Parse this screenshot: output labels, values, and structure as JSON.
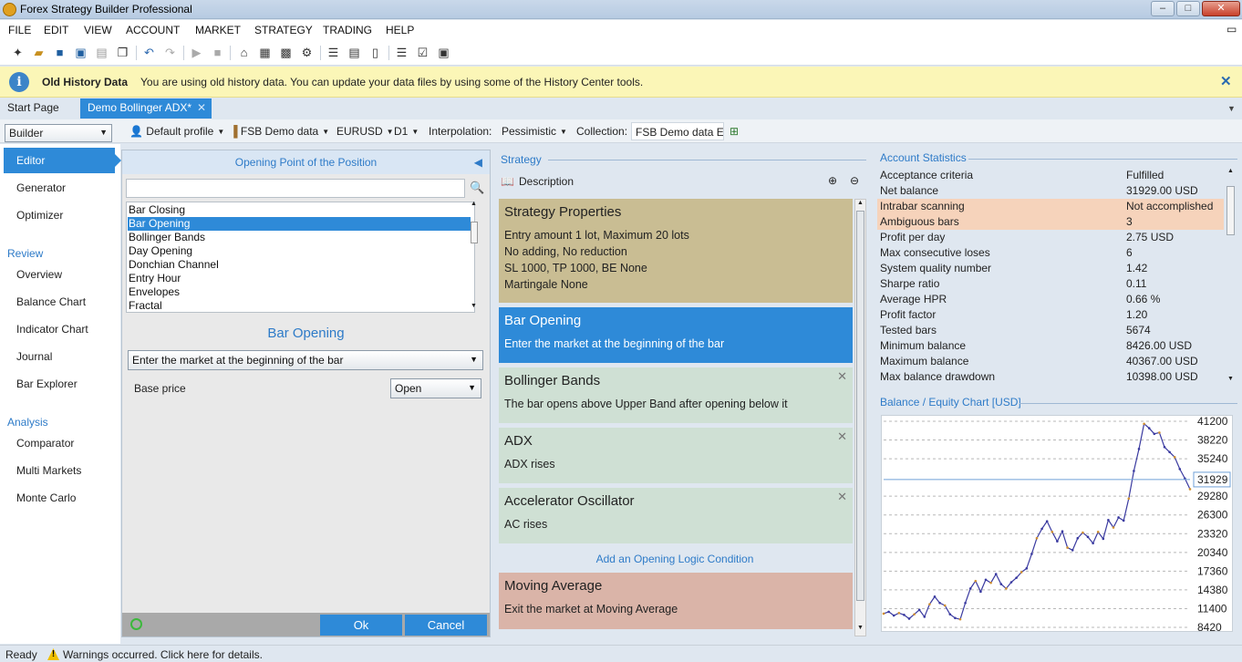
{
  "window": {
    "title": "Forex Strategy Builder Professional"
  },
  "menu": [
    "FILE",
    "EDIT",
    "VIEW",
    "ACCOUNT",
    "MARKET",
    "STRATEGY",
    "TRADING",
    "HELP"
  ],
  "infobar": {
    "title": "Old History Data",
    "message": "You are using old history data. You can update your data files by using some of the History Center tools."
  },
  "tabs": {
    "start": "Start Page",
    "active": "Demo Bollinger ADX*"
  },
  "profilebar": {
    "mode": "Builder",
    "profile": "Default profile",
    "datasource": "FSB Demo data",
    "symbol": "EURUSD",
    "period": "D1",
    "interpolation_label": "Interpolation:",
    "interpolation": "Pessimistic",
    "collection_label": "Collection:",
    "collection": "FSB Demo data EU"
  },
  "nav": {
    "editor": "Editor",
    "generator": "Generator",
    "optimizer": "Optimizer",
    "review": "Review",
    "overview": "Overview",
    "balance_chart": "Balance Chart",
    "indicator_chart": "Indicator Chart",
    "journal": "Journal",
    "bar_explorer": "Bar Explorer",
    "analysis": "Analysis",
    "comparator": "Comparator",
    "multi_markets": "Multi Markets",
    "monte_carlo": "Monte Carlo"
  },
  "editor": {
    "header": "Opening Point of the Position",
    "indicators": [
      "Bar Closing",
      "Bar Opening",
      "Bollinger Bands",
      "Day Opening",
      "Donchian Channel",
      "Entry Hour",
      "Envelopes",
      "Fractal"
    ],
    "selected_index": 1,
    "indicator_title": "Bar Opening",
    "logic": "Enter the market at the beginning of the bar",
    "base_price_label": "Base price",
    "base_price": "Open",
    "ok": "Ok",
    "cancel": "Cancel"
  },
  "strategy": {
    "section": "Strategy",
    "description": "Description",
    "properties": {
      "title": "Strategy Properties",
      "lines": [
        "Entry amount 1 lot, Maximum 20 lots",
        "No adding, No reduction",
        "SL 1000,  TP 1000,  BE None",
        "Martingale None"
      ]
    },
    "opening": {
      "title": "Bar Opening",
      "desc": "Enter the market at the beginning of the bar"
    },
    "conditions": [
      {
        "title": "Bollinger Bands",
        "desc": "The bar opens above Upper Band after opening below it"
      },
      {
        "title": "ADX",
        "desc": "ADX rises"
      },
      {
        "title": "Accelerator Oscillator",
        "desc": "AC rises"
      }
    ],
    "add_condition": "Add an Opening Logic Condition",
    "closing": {
      "title": "Moving Average",
      "desc": "Exit the market at Moving Average"
    }
  },
  "stats": {
    "section": "Account Statistics",
    "rows": [
      {
        "name": "Acceptance criteria",
        "value": "Fulfilled",
        "highlight": false
      },
      {
        "name": "Net balance",
        "value": "31929.00 USD",
        "highlight": false
      },
      {
        "name": "Intrabar scanning",
        "value": "Not accomplished",
        "highlight": true
      },
      {
        "name": "Ambiguous bars",
        "value": "3",
        "highlight": true
      },
      {
        "name": "Profit per day",
        "value": "2.75 USD",
        "highlight": false
      },
      {
        "name": "Max consecutive loses",
        "value": "6",
        "highlight": false
      },
      {
        "name": "System quality number",
        "value": "1.42",
        "highlight": false
      },
      {
        "name": "Sharpe ratio",
        "value": "0.11",
        "highlight": false
      },
      {
        "name": "Average HPR",
        "value": "0.66 %",
        "highlight": false
      },
      {
        "name": "Profit factor",
        "value": "1.20",
        "highlight": false
      },
      {
        "name": "Tested bars",
        "value": "5674",
        "highlight": false
      },
      {
        "name": "Minimum balance",
        "value": "8426.00 USD",
        "highlight": false
      },
      {
        "name": "Maximum balance",
        "value": "40367.00 USD",
        "highlight": false
      },
      {
        "name": "Max balance drawdown",
        "value": "10398.00 USD",
        "highlight": false
      }
    ]
  },
  "chart_data": {
    "type": "line",
    "title": "Balance / Equity Chart [USD]",
    "yticks": [
      41200,
      38220,
      35240,
      31929,
      29280,
      26300,
      23320,
      20340,
      17360,
      14380,
      11400,
      8420
    ],
    "ylim": [
      8420,
      41200
    ],
    "current_value": 31929,
    "series": [
      {
        "values": [
          10600,
          10900,
          10300,
          10700,
          10400,
          9800,
          10500,
          11200,
          10100,
          12100,
          13300,
          12300,
          11900,
          10500,
          9900,
          9700,
          12300,
          14600,
          15800,
          14100,
          16000,
          15500,
          16900,
          15300,
          14600,
          15600,
          16300,
          17200,
          17800,
          20100,
          22600,
          24100,
          25300,
          23600,
          22100,
          23700,
          21100,
          20700,
          22600,
          23500,
          22800,
          21800,
          23600,
          22500,
          25500,
          24300,
          25900,
          25400,
          28900,
          33300,
          36800,
          40800,
          40100,
          39200,
          39400,
          37100,
          36300,
          35500,
          33600,
          32100,
          30400
        ]
      }
    ],
    "colors": {
      "line": "#3a3aa0",
      "up": "#d09030",
      "grid": "#b8b8b8",
      "current": "#6fa0d8"
    }
  },
  "status": {
    "ready": "Ready",
    "warning": "Warnings occurred. Click here for details."
  }
}
